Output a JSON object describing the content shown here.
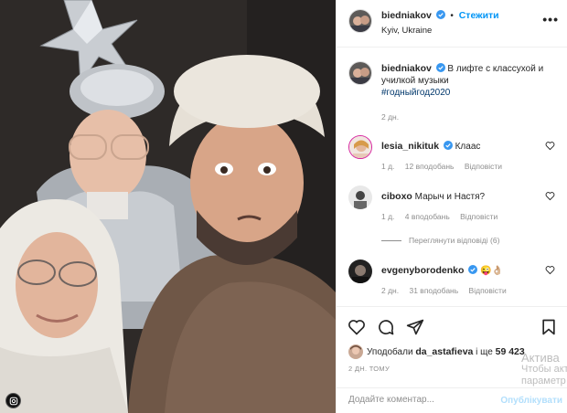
{
  "post": {
    "author": "biedniakov",
    "follow_label": "Стежити",
    "location": "Kyiv, Ukraine",
    "more_label": "•••",
    "caption_text": "В лифте с классухой и училкой музыки",
    "caption_hashtag": "#годныйгод2020",
    "caption_time": "2 дн."
  },
  "comments": [
    {
      "author": "lesia_nikituk",
      "text": "Клаас",
      "time": "1 д.",
      "likes": "12 вподобань",
      "reply": "Відповісти"
    },
    {
      "author": "ciboxo",
      "text": "Марыч и Настя?",
      "time": "1 д.",
      "likes": "4 вподобань",
      "reply": "Відповісти"
    },
    {
      "author": "evgenyborodenko",
      "text": "😜👌🏼",
      "time": "2 дн.",
      "likes": "31 вподобань",
      "reply": "Відповісти"
    }
  ],
  "view_replies": "Переглянути відповіді (6)",
  "likes": {
    "prefix": "Уподобали",
    "user": "da_astafieva",
    "suffix": "і ще",
    "count": "59 423"
  },
  "post_date": "2 ДН. ТОМУ",
  "watermark": {
    "line1": "Актива",
    "line2": "Чтобы акт",
    "line3": "параметр"
  },
  "add_comment": {
    "placeholder": "Додайте коментар...",
    "publish_label": "Опублікувати"
  },
  "colors": {
    "link_blue": "#0095f6",
    "verified_blue": "#3897f0",
    "secondary_text": "#8e8e8e",
    "hashtag": "#00376b"
  },
  "icons": [
    "verified-icon",
    "more-icon",
    "heart-icon",
    "comment-icon",
    "share-icon",
    "bookmark-icon",
    "instagram-icon"
  ]
}
